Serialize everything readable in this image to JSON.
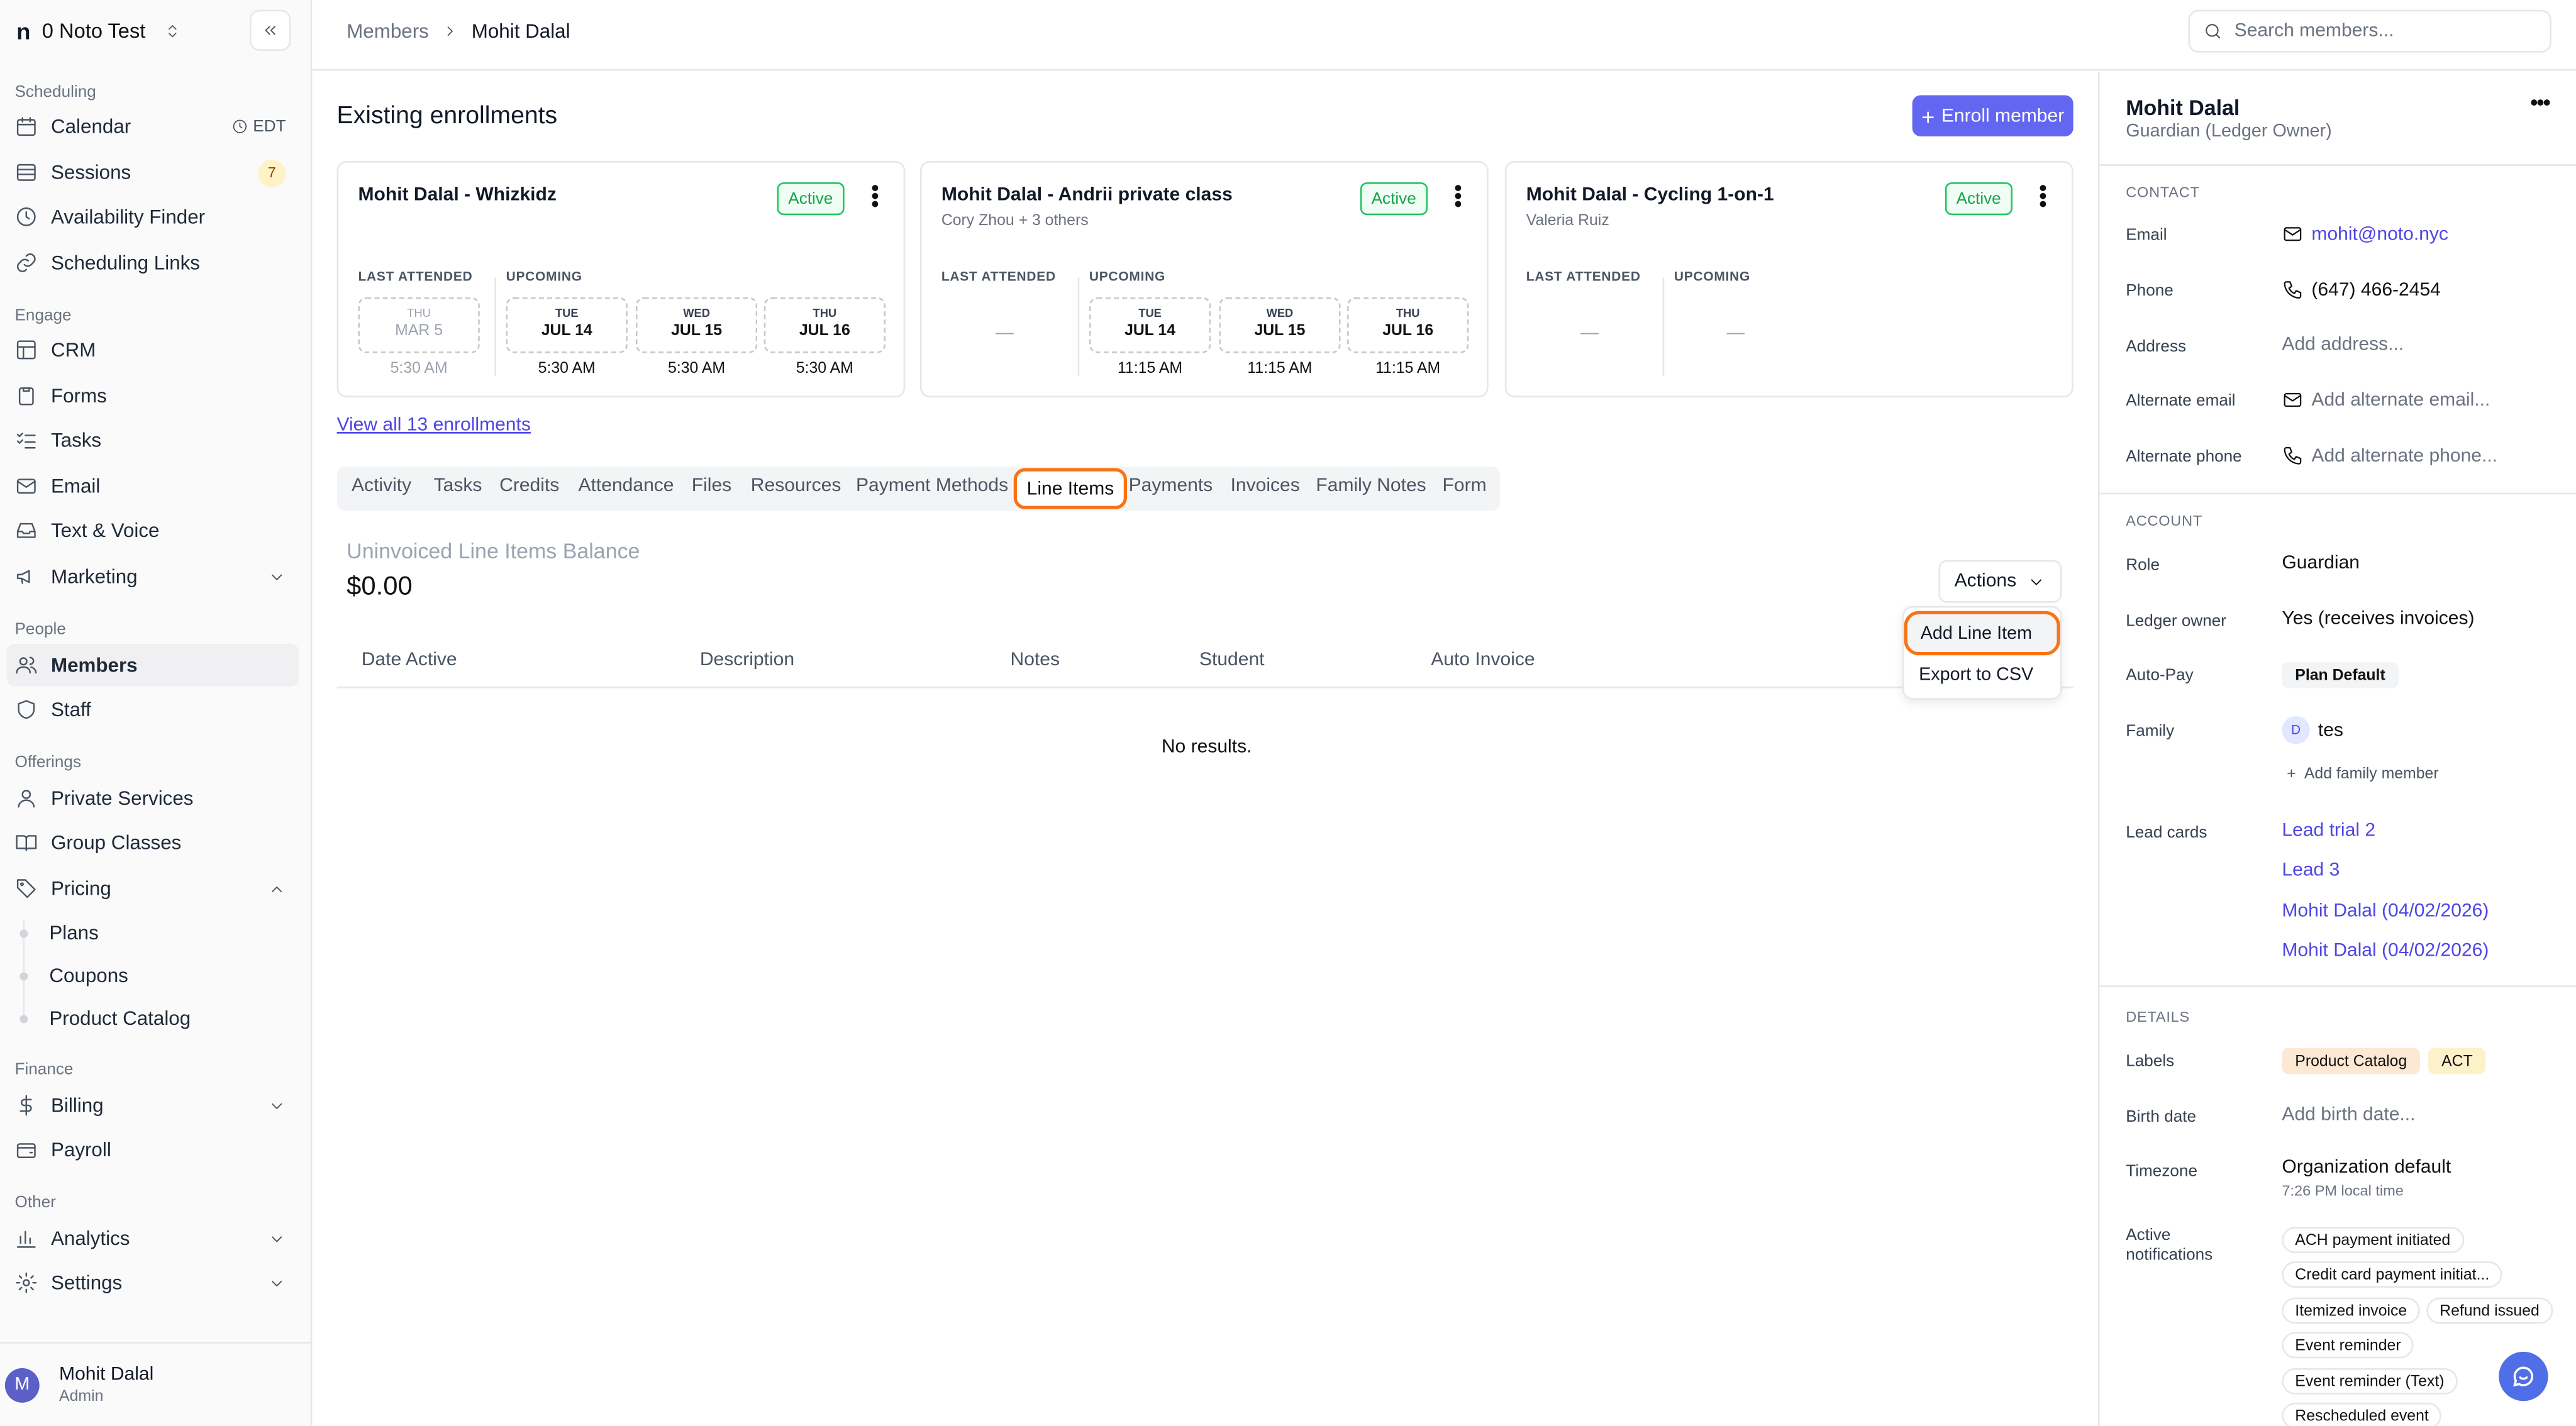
{
  "org": {
    "logo": "n",
    "name": "0 Noto Test"
  },
  "sidebar": {
    "sections": [
      "Scheduling",
      "Engage",
      "People",
      "Offerings",
      "Finance",
      "Other"
    ],
    "scheduling": [
      {
        "label": "Calendar",
        "extra": "EDT"
      },
      {
        "label": "Sessions",
        "badge": "7"
      },
      {
        "label": "Availability Finder"
      },
      {
        "label": "Scheduling Links"
      }
    ],
    "engage": [
      {
        "label": "CRM"
      },
      {
        "label": "Forms"
      },
      {
        "label": "Tasks"
      },
      {
        "label": "Email"
      },
      {
        "label": "Text & Voice"
      },
      {
        "label": "Marketing"
      }
    ],
    "people": [
      {
        "label": "Members"
      },
      {
        "label": "Staff"
      }
    ],
    "offerings": [
      {
        "label": "Private Services"
      },
      {
        "label": "Group Classes"
      },
      {
        "label": "Pricing"
      }
    ],
    "pricing_sub": [
      "Plans",
      "Coupons",
      "Product Catalog"
    ],
    "finance": [
      {
        "label": "Billing"
      },
      {
        "label": "Payroll"
      }
    ],
    "other": [
      {
        "label": "Analytics"
      },
      {
        "label": "Settings"
      }
    ],
    "user": {
      "initial": "M",
      "name": "Mohit Dalal",
      "role": "Admin"
    }
  },
  "topbar": {
    "crumbs": [
      "Members",
      "Mohit Dalal"
    ],
    "search_placeholder": "Search members..."
  },
  "enrollments": {
    "heading": "Existing enrollments",
    "enroll_button": "Enroll member",
    "labels": {
      "last": "LAST ATTENDED",
      "upcoming": "UPCOMING"
    },
    "cards": [
      {
        "title": "Mohit Dalal - Whizkidz",
        "subtitle": "",
        "status": "Active",
        "last": {
          "dow": "THU",
          "date": "MAR 5",
          "time": "5:30 AM"
        },
        "upcoming": [
          {
            "dow": "TUE",
            "date": "JUL 14",
            "time": "5:30 AM"
          },
          {
            "dow": "WED",
            "date": "JUL 15",
            "time": "5:30 AM"
          },
          {
            "dow": "THU",
            "date": "JUL 16",
            "time": "5:30 AM"
          }
        ]
      },
      {
        "title": "Mohit Dalal - Andrii private class",
        "subtitle": "Cory Zhou + 3 others",
        "status": "Active",
        "last_empty": "—",
        "upcoming": [
          {
            "dow": "TUE",
            "date": "JUL 14",
            "time": "11:15 AM"
          },
          {
            "dow": "WED",
            "date": "JUL 15",
            "time": "11:15 AM"
          },
          {
            "dow": "THU",
            "date": "JUL 16",
            "time": "11:15 AM"
          }
        ]
      },
      {
        "title": "Mohit Dalal - Cycling 1-on-1",
        "subtitle": "Valeria Ruiz",
        "status": "Active",
        "last_empty": "—",
        "upcoming_empty": "—"
      }
    ],
    "view_all": "View all 13 enrollments"
  },
  "tabs": [
    "Activity",
    "Tasks",
    "Credits",
    "Attendance",
    "Files",
    "Resources",
    "Payment Methods",
    "Line Items",
    "Payments",
    "Invoices",
    "Family Notes",
    "Form"
  ],
  "line_items": {
    "balance_label": "Uninvoiced Line Items Balance",
    "balance": "$0.00",
    "actions_label": "Actions",
    "menu": [
      "Add Line Item",
      "Export to CSV"
    ],
    "columns": [
      "Date Active",
      "Description",
      "Notes",
      "Student",
      "Auto Invoice"
    ],
    "empty": "No results."
  },
  "panel": {
    "name": "Mohit Dalal",
    "role": "Guardian (Ledger Owner)",
    "contact_title": "CONTACT",
    "email_k": "Email",
    "email": "mohit@noto.nyc",
    "phone_k": "Phone",
    "phone": "(647) 466-2454",
    "address_k": "Address",
    "address": "Add address...",
    "alt_email_k": "Alternate email",
    "alt_email": "Add alternate email...",
    "alt_phone_k": "Alternate phone",
    "alt_phone": "Add alternate phone...",
    "account_title": "ACCOUNT",
    "role_k": "Role",
    "role_v": "Guardian",
    "ledger_k": "Ledger owner",
    "ledger_v": "Yes (receives invoices)",
    "autopay_k": "Auto-Pay",
    "autopay_v": "Plan Default",
    "family_k": "Family",
    "family_initial": "D",
    "family_v": "tes",
    "add_family": "Add family member",
    "lead_k": "Lead cards",
    "leads": [
      "Lead trial 2",
      "Lead 3",
      "Mohit Dalal (04/02/2026)",
      "Mohit Dalal (04/02/2026)"
    ],
    "details_title": "DETAILS",
    "labels_k": "Labels",
    "labels": [
      "Product Catalog",
      "ACT"
    ],
    "birth_k": "Birth date",
    "birth_v": "Add birth date...",
    "tz_k": "Timezone",
    "tz_v": "Organization default",
    "tz_local": "7:26 PM local time",
    "notif_k": "Active notifications",
    "notifications": [
      "ACH payment initiated",
      "Credit card payment initiat...",
      "Itemized invoice",
      "Refund issued",
      "Event reminder",
      "Event reminder (Text)",
      "Rescheduled event"
    ]
  },
  "colors": {
    "accent": "#6366f1",
    "active_green": "#16a34a",
    "highlight": "#f97316"
  }
}
